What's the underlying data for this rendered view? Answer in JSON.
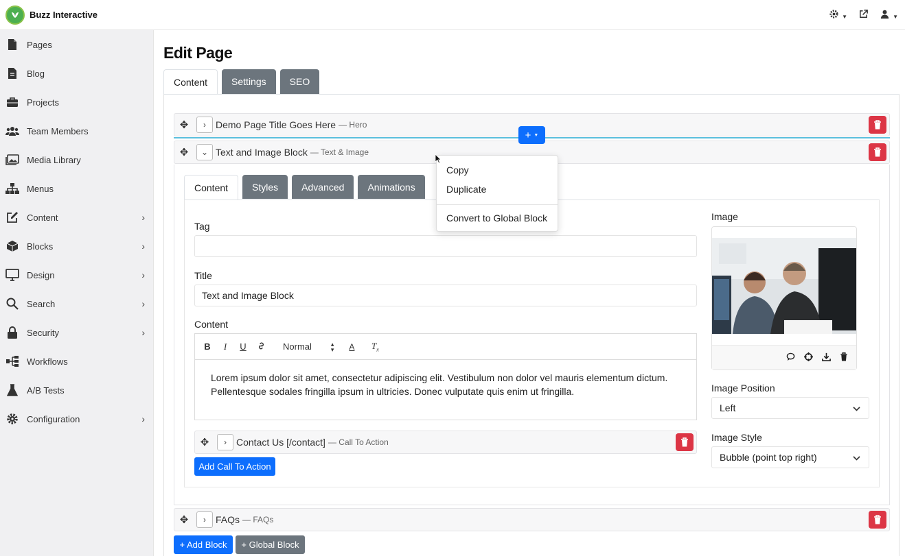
{
  "app": {
    "name": "Buzz Interactive"
  },
  "sidebar": {
    "items": [
      {
        "label": "Pages",
        "icon": "file-icon"
      },
      {
        "label": "Blog",
        "icon": "document-icon"
      },
      {
        "label": "Projects",
        "icon": "briefcase-icon"
      },
      {
        "label": "Team Members",
        "icon": "users-icon"
      },
      {
        "label": "Media Library",
        "icon": "images-icon"
      },
      {
        "label": "Menus",
        "icon": "sitemap-icon"
      },
      {
        "label": "Content",
        "icon": "edit-icon"
      },
      {
        "label": "Blocks",
        "icon": "cube-icon"
      },
      {
        "label": "Design",
        "icon": "monitor-icon"
      },
      {
        "label": "Search",
        "icon": "search-icon"
      },
      {
        "label": "Security",
        "icon": "lock-icon"
      },
      {
        "label": "Workflows",
        "icon": "workflow-icon"
      },
      {
        "label": "A/B Tests",
        "icon": "flask-icon"
      },
      {
        "label": "Configuration",
        "icon": "gear-icon"
      }
    ]
  },
  "main": {
    "title": "Edit Page",
    "tabs": [
      {
        "label": "Content",
        "active": true
      },
      {
        "label": "Settings"
      },
      {
        "label": "SEO"
      }
    ]
  },
  "blocks": {
    "hero": {
      "title": "Demo Page Title Goes Here",
      "type": "— Hero"
    },
    "text_image": {
      "title": "Text and Image Block",
      "type": "— Text & Image"
    },
    "faqs": {
      "title": "FAQs",
      "type": "— FAQs"
    }
  },
  "block_editor": {
    "tabs": [
      {
        "label": "Content",
        "active": true
      },
      {
        "label": "Styles"
      },
      {
        "label": "Advanced"
      },
      {
        "label": "Animations"
      }
    ],
    "tag_label": "Tag",
    "tag_value": "",
    "title_label": "Title",
    "title_value": "Text and Image Block",
    "content_label": "Content",
    "format_select": "Normal",
    "content_text": "Lorem ipsum dolor sit amet, consectetur adipiscing elit. Vestibulum non dolor vel mauris elementum dictum. Pellentesque sodales fringilla ipsum in ultricies. Donec vulputate quis enim ut fringilla.",
    "cta": {
      "title": "Contact Us [/contact]",
      "type": "— Call To Action"
    },
    "add_cta_label": "Add Call To Action",
    "image_label": "Image",
    "image_position_label": "Image Position",
    "image_position_value": "Left",
    "image_style_label": "Image Style",
    "image_style_value": "Bubble (point top right)"
  },
  "context_menu": {
    "copy": "Copy",
    "duplicate": "Duplicate",
    "convert": "Convert to Global Block"
  },
  "footer_buttons": {
    "add_block": "+ Add Block",
    "global_block": "+ Global Block"
  },
  "colors": {
    "primary": "#0d6efd",
    "danger": "#dc3545",
    "secondary": "#6c757d",
    "brand_green": "#4caf50",
    "insert_line": "#5bc0de"
  }
}
